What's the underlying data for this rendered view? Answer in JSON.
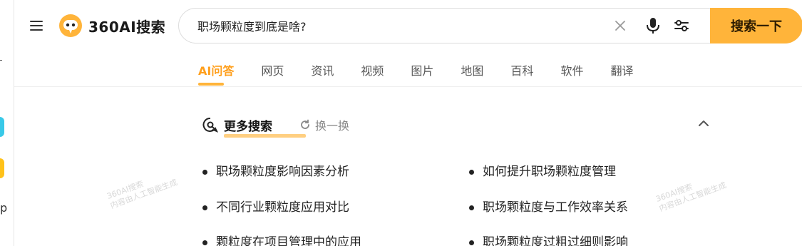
{
  "logo": {
    "text": "360AI搜索",
    "icon": "robot-logo-icon"
  },
  "search": {
    "query": "职场颗粒度到底是啥?",
    "button_label": "搜索一下",
    "icons": [
      "clear-icon",
      "microphone-icon",
      "filter-settings-icon",
      "menu-icon"
    ]
  },
  "tabs": [
    {
      "label": "AI问答",
      "active": true
    },
    {
      "label": "网页"
    },
    {
      "label": "资讯"
    },
    {
      "label": "视频"
    },
    {
      "label": "图片"
    },
    {
      "label": "地图"
    },
    {
      "label": "百科"
    },
    {
      "label": "软件"
    },
    {
      "label": "翻译"
    }
  ],
  "more_search": {
    "title": "更多搜索",
    "refresh_label": "换一换",
    "items": [
      "职场颗粒度影响因素分析",
      "如何提升职场颗粒度管理",
      "不同行业颗粒度应用对比",
      "职场颗粒度与工作效率关系",
      "颗粒度在项目管理中的应用",
      "职场颗粒度过粗过细则影响"
    ]
  },
  "watermark": {
    "line1": "360AI搜索",
    "line2": "内容由人工智能生成"
  },
  "colors": {
    "accent": "#ffb43a",
    "active_tab": "#ff9f1c",
    "cyan_chip": "#39c9e8",
    "yellow_chip": "#ffc21a"
  }
}
